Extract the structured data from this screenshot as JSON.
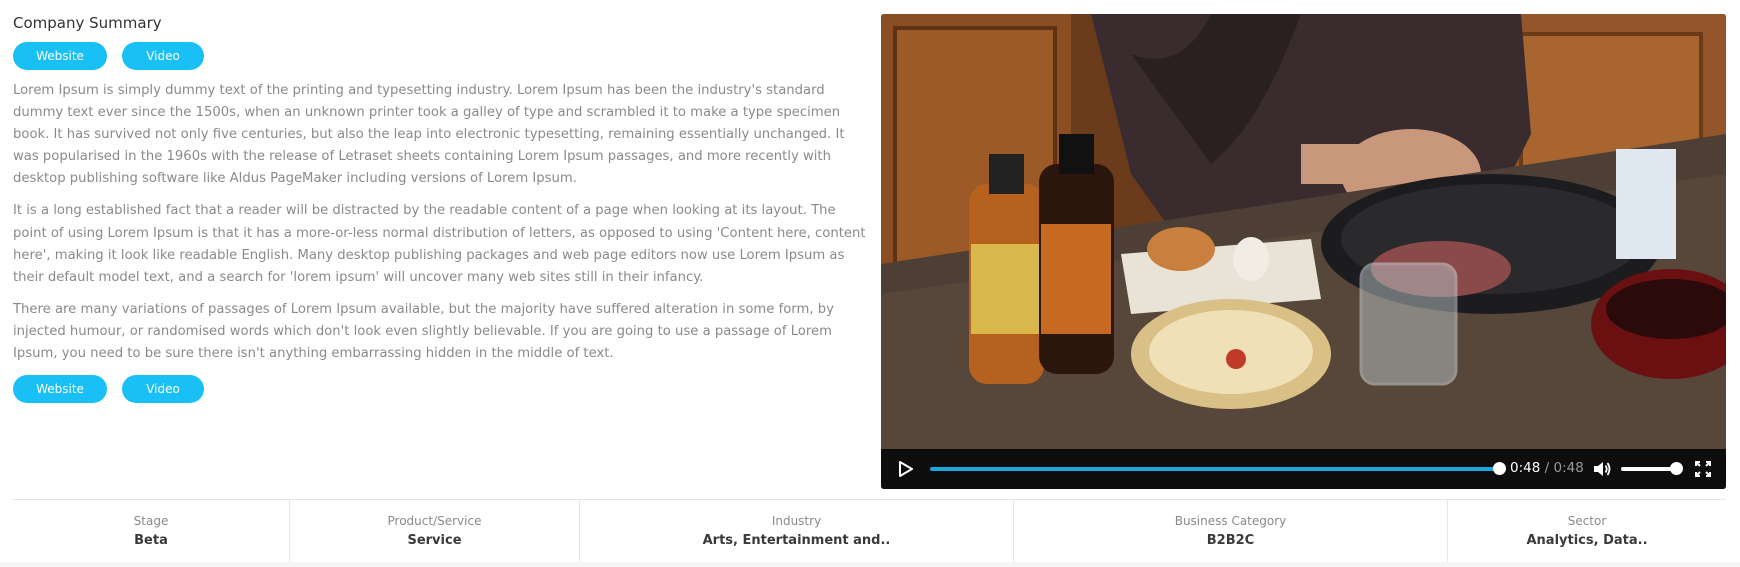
{
  "summary": {
    "title": "Company Summary",
    "top_buttons": {
      "website": "Website",
      "video": "Video"
    },
    "paragraphs": [
      "Lorem Ipsum is simply dummy text of the printing and typesetting industry. Lorem Ipsum has been the industry's standard dummy text ever since the 1500s, when an unknown printer took a galley of type and scrambled it to make a type specimen book. It has survived not only five centuries, but also the leap into electronic typesetting, remaining essentially unchanged. It was popularised in the 1960s with the release of Letraset sheets containing Lorem Ipsum passages, and more recently with desktop publishing software like Aldus PageMaker including versions of Lorem Ipsum.",
      "It is a long established fact that a reader will be distracted by the readable content of a page when looking at its layout. The point of using Lorem Ipsum is that it has a more-or-less normal distribution of letters, as opposed to using 'Content here, content here', making it look like readable English. Many desktop publishing packages and web page editors now use Lorem Ipsum as their default model text, and a search for 'lorem ipsum' will uncover many web sites still in their infancy.",
      "There are many variations of passages of Lorem Ipsum available, but the majority have suffered alteration in some form, by injected humour, or randomised words which don't look even slightly believable. If you are going to use a passage of Lorem Ipsum, you need to be sure there isn't anything embarrassing hidden in the middle of text."
    ],
    "bottom_buttons": {
      "website": "Website",
      "video": "Video"
    }
  },
  "video": {
    "current_time": "0:48",
    "separator": "/",
    "duration": "0:48",
    "progress": 1.0,
    "volume": 0.9,
    "icons": {
      "play": "play-icon",
      "volume": "volume-icon",
      "fullscreen": "fullscreen-icon"
    }
  },
  "stats": [
    {
      "label": "Stage",
      "value": "Beta"
    },
    {
      "label": "Product/Service",
      "value": "Service"
    },
    {
      "label": "Industry",
      "value": "Arts, Entertainment and.."
    },
    {
      "label": "Business Category",
      "value": "B2B2C"
    },
    {
      "label": "Sector",
      "value": "Analytics, Data.."
    }
  ],
  "colors": {
    "accent": "#19c0f6",
    "progress": "#1aa7e0",
    "text_muted": "#8a8a8a"
  }
}
